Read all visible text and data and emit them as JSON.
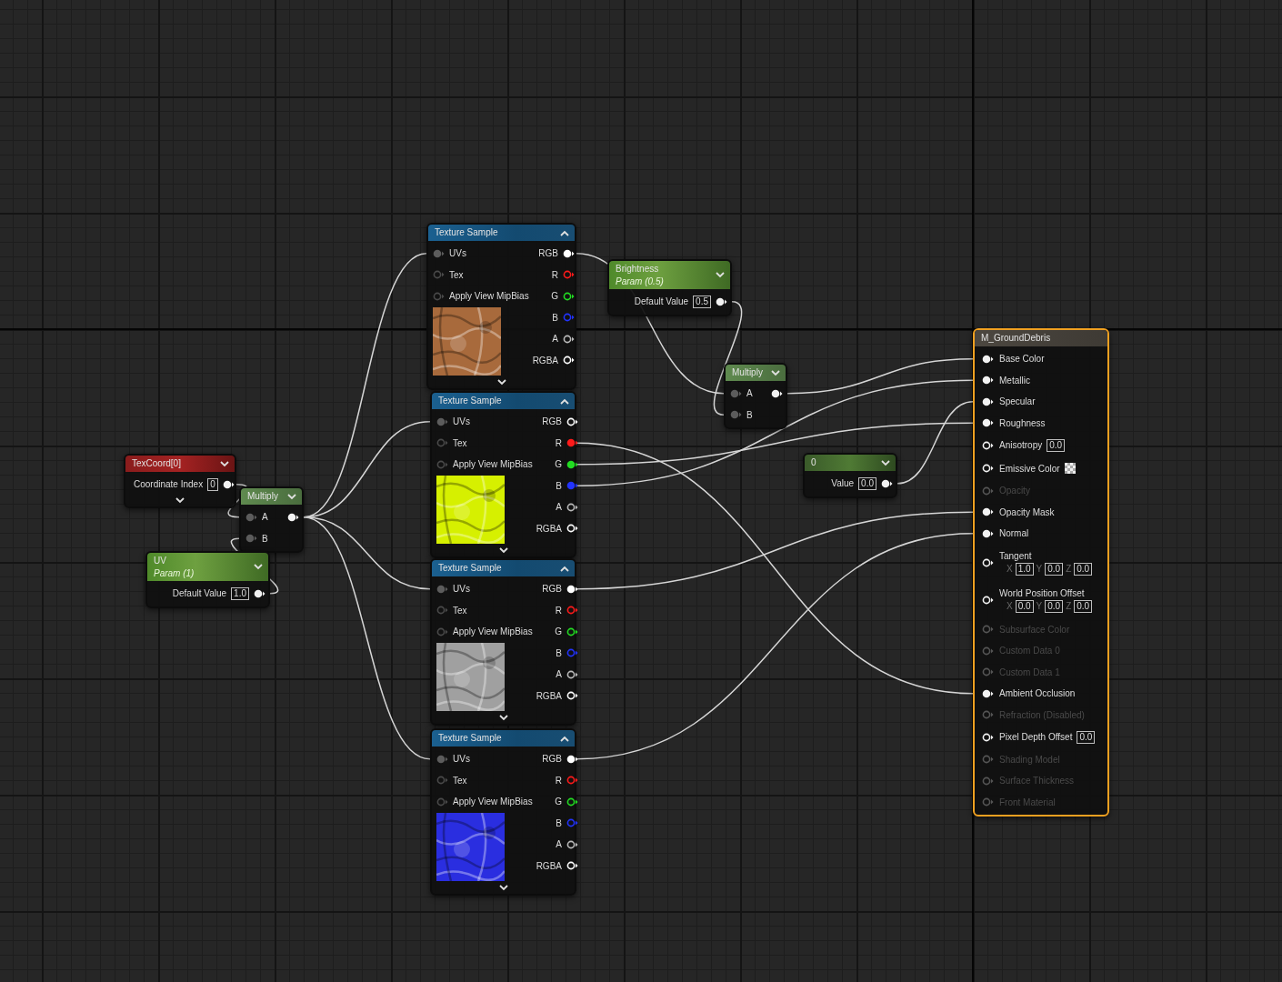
{
  "nodes": [
    {
      "title": "TexCoord[0]",
      "kind": "coordinate",
      "selected": false,
      "expanded": false,
      "more_pins": true,
      "outputs": [
        {
          "label": "Coordinate Index",
          "value": "0",
          "connected": true
        }
      ]
    },
    {
      "title": "Multiply",
      "kind": "math",
      "selected": false,
      "expanded": false,
      "more_pins": false,
      "inputs": [
        {
          "label": "A",
          "connected": true
        },
        {
          "label": "B",
          "connected": true
        }
      ],
      "outputs": [
        {
          "connected": true
        }
      ]
    },
    {
      "title": "UV",
      "subtitle": "Param (1)",
      "kind": "parameter",
      "selected": false,
      "expanded": false,
      "more_pins": false,
      "outputs": [
        {
          "label": "Default Value",
          "value": "1.0",
          "connected": true
        }
      ]
    },
    {
      "title": "Texture Sample",
      "kind": "texture",
      "selected": false,
      "expanded": true,
      "more_pins": true,
      "inputs": [
        {
          "label": "UVs",
          "connected": true
        },
        {
          "label": "Tex",
          "connected": false
        },
        {
          "label": "Apply View MipBias",
          "connected": false
        }
      ],
      "outputs": [
        {
          "label": "RGB",
          "connected": true,
          "color": "#ffffff"
        },
        {
          "label": "R",
          "connected": false,
          "color": "#ff1a1a"
        },
        {
          "label": "G",
          "connected": false,
          "color": "#22dd22"
        },
        {
          "label": "B",
          "connected": false,
          "color": "#2233ff"
        },
        {
          "label": "A",
          "connected": false,
          "color": "#bbbbbb"
        },
        {
          "label": "RGBA",
          "connected": false,
          "color": "#ffffff"
        }
      ]
    },
    {
      "title": "Texture Sample",
      "kind": "texture",
      "selected": false,
      "expanded": true,
      "more_pins": true,
      "inputs": [
        {
          "label": "UVs",
          "connected": true
        },
        {
          "label": "Tex",
          "connected": false
        },
        {
          "label": "Apply View MipBias",
          "connected": false
        }
      ],
      "outputs": [
        {
          "label": "RGB",
          "connected": false,
          "color": "#ffffff"
        },
        {
          "label": "R",
          "connected": true,
          "color": "#ff1a1a"
        },
        {
          "label": "G",
          "connected": true,
          "color": "#22dd22"
        },
        {
          "label": "B",
          "connected": true,
          "color": "#2233ff"
        },
        {
          "label": "A",
          "connected": false,
          "color": "#bbbbbb"
        },
        {
          "label": "RGBA",
          "connected": false,
          "color": "#ffffff"
        }
      ]
    },
    {
      "title": "Texture Sample",
      "kind": "texture",
      "selected": false,
      "expanded": true,
      "more_pins": true,
      "inputs": [
        {
          "label": "UVs",
          "connected": true
        },
        {
          "label": "Tex",
          "connected": false
        },
        {
          "label": "Apply View MipBias",
          "connected": false
        }
      ],
      "outputs": [
        {
          "label": "RGB",
          "connected": true,
          "color": "#ffffff"
        },
        {
          "label": "R",
          "connected": false,
          "color": "#ff1a1a"
        },
        {
          "label": "G",
          "connected": false,
          "color": "#22dd22"
        },
        {
          "label": "B",
          "connected": false,
          "color": "#2233ff"
        },
        {
          "label": "A",
          "connected": false,
          "color": "#bbbbbb"
        },
        {
          "label": "RGBA",
          "connected": false,
          "color": "#ffffff"
        }
      ]
    },
    {
      "title": "Texture Sample",
      "kind": "texture",
      "selected": false,
      "expanded": true,
      "more_pins": true,
      "inputs": [
        {
          "label": "UVs",
          "connected": true
        },
        {
          "label": "Tex",
          "connected": false
        },
        {
          "label": "Apply View MipBias",
          "connected": false
        }
      ],
      "outputs": [
        {
          "label": "RGB",
          "connected": true,
          "color": "#ffffff"
        },
        {
          "label": "R",
          "connected": false,
          "color": "#ff1a1a"
        },
        {
          "label": "G",
          "connected": false,
          "color": "#22dd22"
        },
        {
          "label": "B",
          "connected": false,
          "color": "#2233ff"
        },
        {
          "label": "A",
          "connected": false,
          "color": "#bbbbbb"
        },
        {
          "label": "RGBA",
          "connected": false,
          "color": "#ffffff"
        }
      ]
    },
    {
      "title": "Brightness",
      "subtitle": "Param (0.5)",
      "kind": "parameter",
      "selected": false,
      "expanded": false,
      "more_pins": false,
      "outputs": [
        {
          "label": "Default Value",
          "value": "0.5",
          "connected": true
        }
      ]
    },
    {
      "title": "Multiply",
      "kind": "math",
      "selected": false,
      "expanded": false,
      "more_pins": false,
      "inputs": [
        {
          "label": "A",
          "connected": true
        },
        {
          "label": "B",
          "connected": true
        }
      ],
      "outputs": [
        {
          "connected": true
        }
      ]
    },
    {
      "title": "0",
      "kind": "constant",
      "selected": false,
      "expanded": false,
      "more_pins": false,
      "outputs": [
        {
          "label": "Value",
          "value": "0.0",
          "connected": true
        }
      ]
    },
    {
      "title": "M_GroundDebris",
      "kind": "material",
      "selected": true,
      "inputs": [
        {
          "label": "Base Color",
          "connected": true,
          "disabled": false
        },
        {
          "label": "Metallic",
          "connected": true,
          "disabled": false
        },
        {
          "label": "Specular",
          "connected": true,
          "disabled": false
        },
        {
          "label": "Roughness",
          "connected": true,
          "disabled": false
        },
        {
          "label": "Anisotropy",
          "connected": false,
          "disabled": false,
          "value": "0.0"
        },
        {
          "label": "Emissive Color",
          "connected": false,
          "disabled": false,
          "swatch": true
        },
        {
          "label": "Opacity",
          "connected": false,
          "disabled": true
        },
        {
          "label": "Opacity Mask",
          "connected": true,
          "disabled": false
        },
        {
          "label": "Normal",
          "connected": true,
          "disabled": false
        },
        {
          "label": "Tangent",
          "connected": false,
          "disabled": false,
          "vector": [
            {
              "axis": "X",
              "value": "1.0"
            },
            {
              "axis": "Y",
              "value": "0.0"
            },
            {
              "axis": "Z",
              "value": "0.0"
            }
          ]
        },
        {
          "label": "World Position Offset",
          "connected": false,
          "disabled": false,
          "vector": [
            {
              "axis": "X",
              "value": "0.0"
            },
            {
              "axis": "Y",
              "value": "0.0"
            },
            {
              "axis": "Z",
              "value": "0.0"
            }
          ]
        },
        {
          "label": "Subsurface Color",
          "connected": false,
          "disabled": true
        },
        {
          "label": "Custom Data 0",
          "connected": false,
          "disabled": true
        },
        {
          "label": "Custom Data 1",
          "connected": false,
          "disabled": true
        },
        {
          "label": "Ambient Occlusion",
          "connected": true,
          "disabled": false
        },
        {
          "label": "Refraction (Disabled)",
          "connected": false,
          "disabled": true
        },
        {
          "label": "Pixel Depth Offset",
          "connected": false,
          "disabled": false,
          "value": "0.0"
        },
        {
          "label": "Shading Model",
          "connected": false,
          "disabled": true
        },
        {
          "label": "Surface Thickness",
          "connected": false,
          "disabled": true
        },
        {
          "label": "Front Material",
          "connected": false,
          "disabled": true
        }
      ]
    }
  ]
}
